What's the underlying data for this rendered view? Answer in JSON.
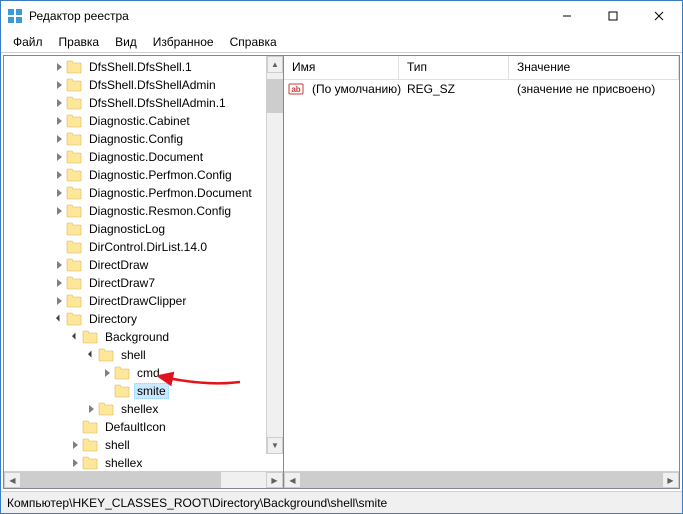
{
  "window": {
    "title": "Редактор реестра"
  },
  "menu": {
    "file": "Файл",
    "edit": "Правка",
    "view": "Вид",
    "favorites": "Избранное",
    "help": "Справка"
  },
  "tree": {
    "items": [
      {
        "depth": 3,
        "twisty": "closed",
        "label": "DfsShell.DfsShell.1"
      },
      {
        "depth": 3,
        "twisty": "closed",
        "label": "DfsShell.DfsShellAdmin"
      },
      {
        "depth": 3,
        "twisty": "closed",
        "label": "DfsShell.DfsShellAdmin.1"
      },
      {
        "depth": 3,
        "twisty": "closed",
        "label": "Diagnostic.Cabinet"
      },
      {
        "depth": 3,
        "twisty": "closed",
        "label": "Diagnostic.Config"
      },
      {
        "depth": 3,
        "twisty": "closed",
        "label": "Diagnostic.Document"
      },
      {
        "depth": 3,
        "twisty": "closed",
        "label": "Diagnostic.Perfmon.Config"
      },
      {
        "depth": 3,
        "twisty": "closed",
        "label": "Diagnostic.Perfmon.Document"
      },
      {
        "depth": 3,
        "twisty": "closed",
        "label": "Diagnostic.Resmon.Config"
      },
      {
        "depth": 3,
        "twisty": "noline",
        "label": "DiagnosticLog",
        "dotted": true
      },
      {
        "depth": 3,
        "twisty": "noline",
        "label": "DirControl.DirList.14.0",
        "dotted": true
      },
      {
        "depth": 3,
        "twisty": "closed",
        "label": "DirectDraw"
      },
      {
        "depth": 3,
        "twisty": "closed",
        "label": "DirectDraw7"
      },
      {
        "depth": 3,
        "twisty": "closed",
        "label": "DirectDrawClipper"
      },
      {
        "depth": 3,
        "twisty": "open",
        "label": "Directory"
      },
      {
        "depth": 4,
        "twisty": "open",
        "label": "Background"
      },
      {
        "depth": 5,
        "twisty": "open",
        "label": "shell"
      },
      {
        "depth": 6,
        "twisty": "closed",
        "label": "cmd"
      },
      {
        "depth": 6,
        "twisty": "noline",
        "label": "smite",
        "selected": true
      },
      {
        "depth": 5,
        "twisty": "closed",
        "label": "shellex"
      },
      {
        "depth": 4,
        "twisty": "noline",
        "label": "DefaultIcon",
        "dotted": true
      },
      {
        "depth": 4,
        "twisty": "closed",
        "label": "shell"
      },
      {
        "depth": 4,
        "twisty": "closed",
        "label": "shellex"
      }
    ]
  },
  "list": {
    "cols": {
      "name": "Имя",
      "type": "Тип",
      "value": "Значение"
    },
    "row": {
      "name": "(По умолчанию)",
      "type": "REG_SZ",
      "value": "(значение не присвоено)"
    }
  },
  "status": {
    "path": "Компьютер\\HKEY_CLASSES_ROOT\\Directory\\Background\\shell\\smite"
  }
}
